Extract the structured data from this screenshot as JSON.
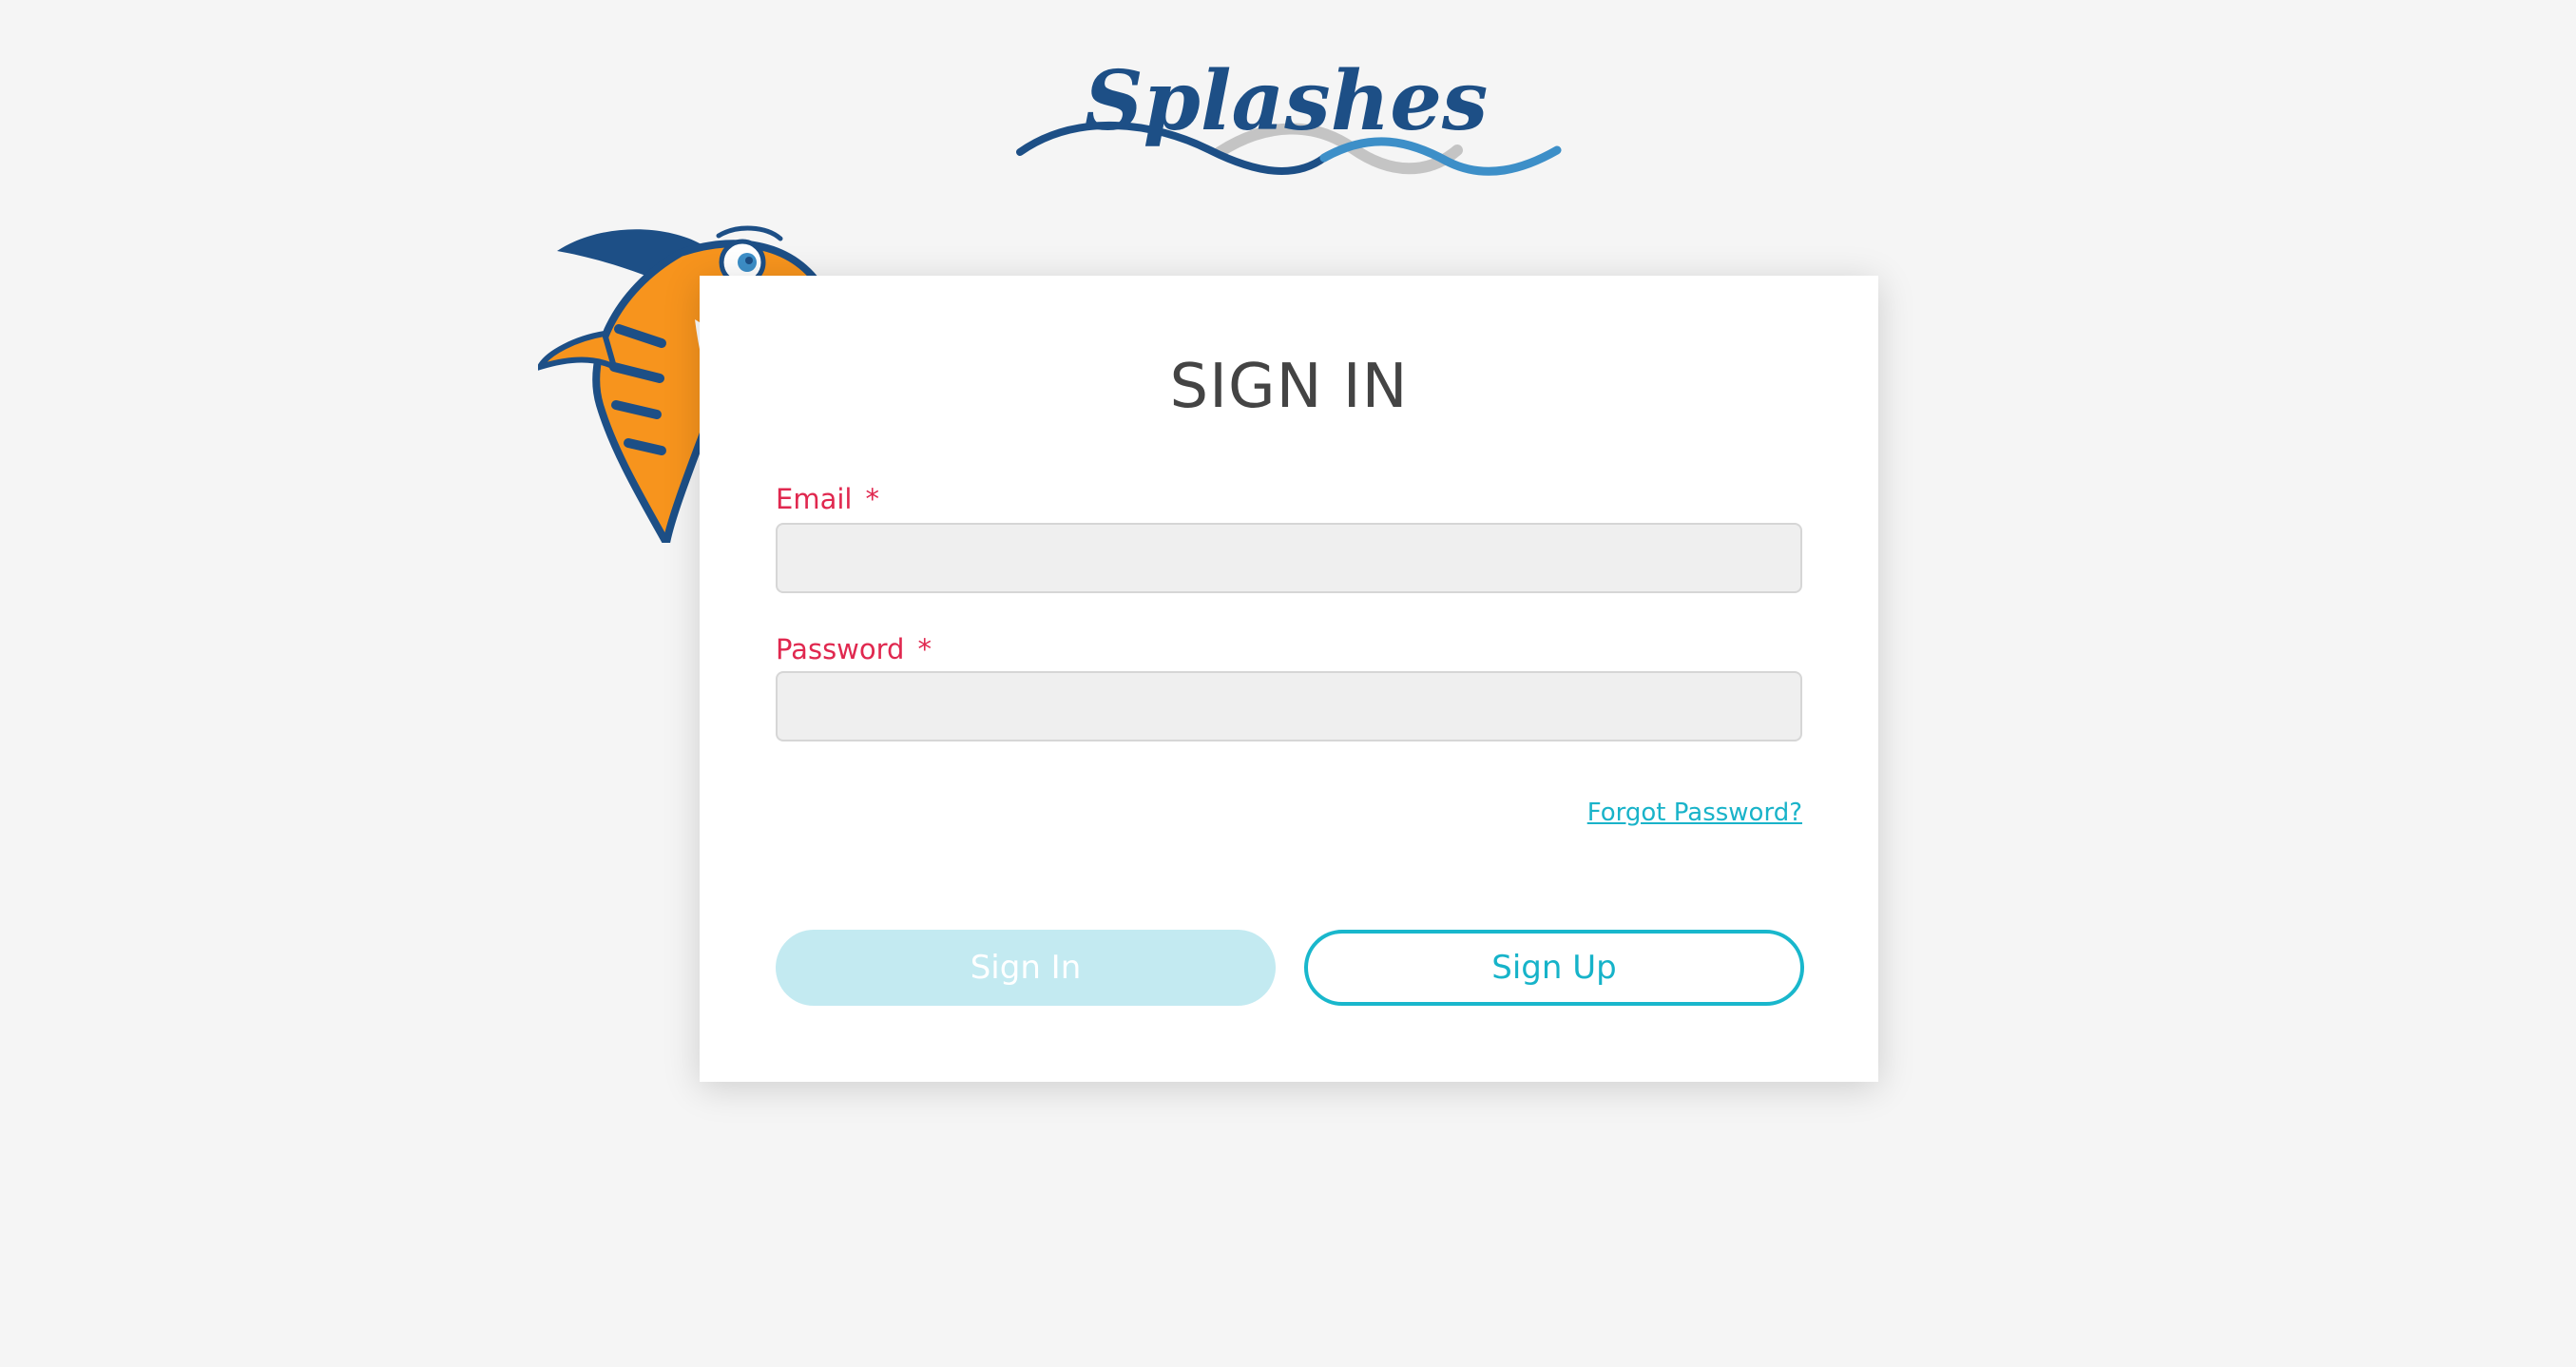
{
  "brand": {
    "logo_text": "Splashes",
    "colors": {
      "logo_blue": "#1d4f86",
      "wave_light_blue": "#3d8fc8",
      "wave_gray": "#c4c4c4",
      "mascot_orange": "#f7941d",
      "mascot_navy": "#1d4f86"
    }
  },
  "form": {
    "title": "SIGN IN",
    "email": {
      "label": "Email",
      "required_mark": "*",
      "value": "",
      "placeholder": ""
    },
    "password": {
      "label": "Password",
      "required_mark": "*",
      "value": "",
      "placeholder": ""
    },
    "forgot_password_link": "Forgot Password?",
    "sign_in_button": "Sign In",
    "sign_up_button": "Sign Up"
  },
  "theme": {
    "background": "#f5f5f5",
    "label_color": "#e0284f",
    "accent": "#19b7cc",
    "disabled_button": "#c3eaf1"
  }
}
